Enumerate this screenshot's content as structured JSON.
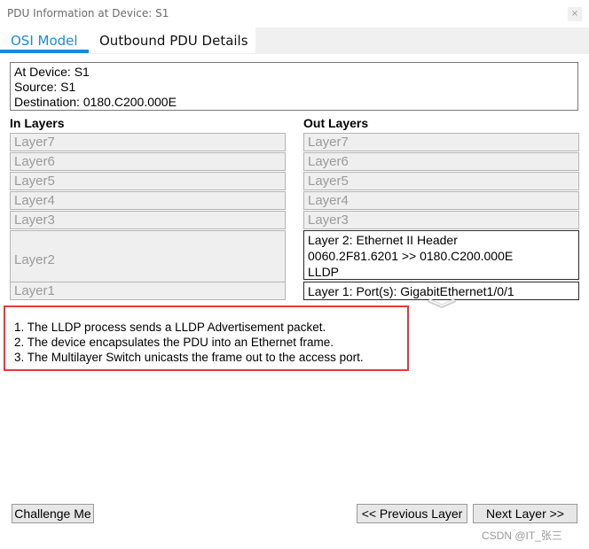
{
  "window": {
    "title": "PDU Information at Device: S1",
    "close_icon": "×"
  },
  "tabs": [
    {
      "label": "OSI Model",
      "selected": true
    },
    {
      "label": "Outbound PDU Details",
      "selected": false
    }
  ],
  "info": {
    "lines": [
      "At Device: S1",
      "Source: S1",
      "Destination: 0180.C200.000E"
    ]
  },
  "in_layers": {
    "heading": "In Layers",
    "items": [
      "Layer7",
      "Layer6",
      "Layer5",
      "Layer4",
      "Layer3",
      "Layer2",
      "Layer1"
    ]
  },
  "out_layers": {
    "heading": "Out Layers",
    "items": [
      "Layer7",
      "Layer6",
      "Layer5",
      "Layer4",
      "Layer3"
    ],
    "layer2_lines": [
      "Layer 2: Ethernet II Header",
      "0060.2F81.6201 >> 0180.C200.000E",
      "LLDP"
    ],
    "layer1": "Layer 1: Port(s): GigabitEthernet1/0/1"
  },
  "description": {
    "lines": [
      "1. The LLDP process sends a LLDP Advertisement packet.",
      "2. The device encapsulates the PDU into an Ethernet frame.",
      "3. The Multilayer Switch unicasts the frame out to the access port."
    ]
  },
  "buttons": {
    "challenge": "Challenge Me",
    "previous": "<< Previous Layer",
    "next": "Next Layer >>"
  },
  "watermark": "CSDN @IT_张三",
  "colors": {
    "accent": "#1e8ad6",
    "highlight_border": "#e33a3a"
  }
}
